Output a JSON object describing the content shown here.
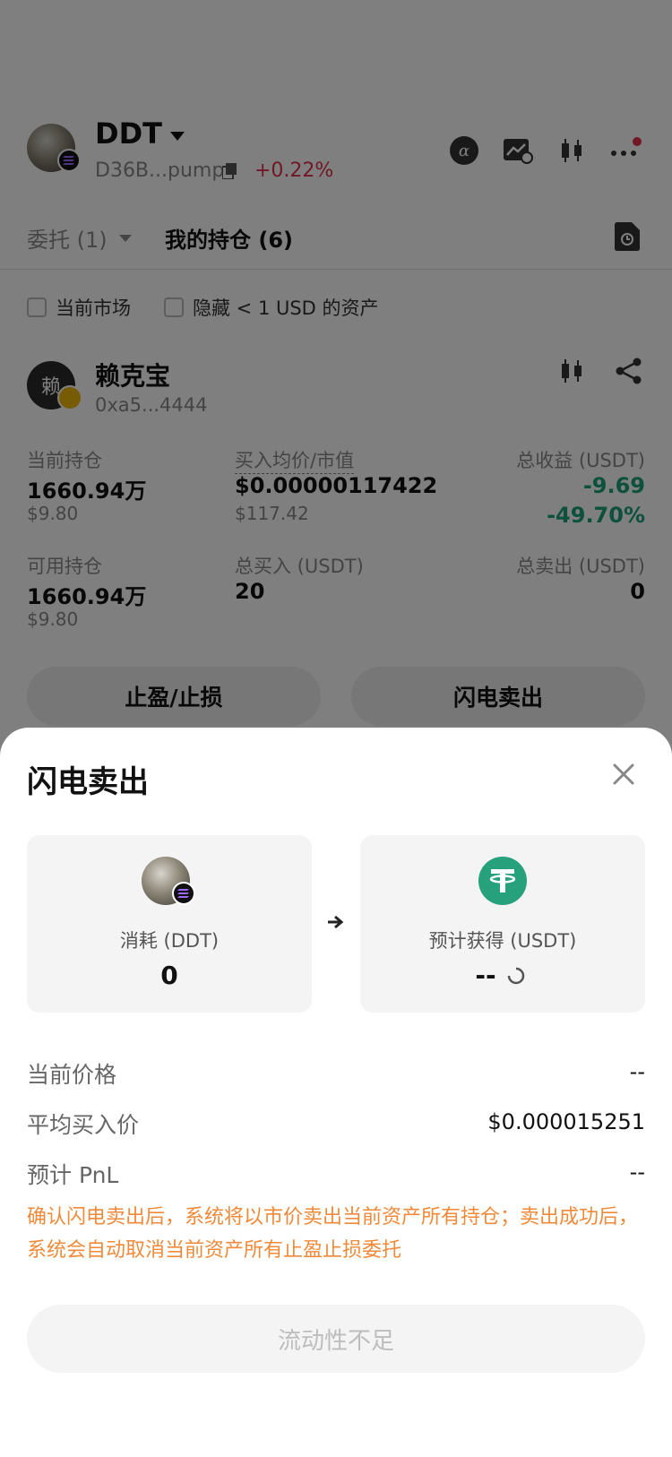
{
  "header": {
    "token_name": "DDT",
    "token_address": "D36B...pump",
    "price_change": "+0.22%"
  },
  "tabs": {
    "orders": "委托 (1)",
    "holdings": "我的持仓 (6)"
  },
  "filters": {
    "current_market": "当前市场",
    "hide_small": "隐藏 < 1 USD 的资产"
  },
  "position": {
    "avatar_text": "赖",
    "name": "赖克宝",
    "address": "0xa5...4444",
    "current_holding_label": "当前持仓",
    "current_holding_value": "1660.94万",
    "current_holding_usd": "$9.80",
    "avg_price_label": "买入均价/市值",
    "avg_price_value": "$0.00000117422",
    "market_value": "$117.42",
    "total_profit_label": "总收益 (USDT)",
    "total_profit_value": "-9.69",
    "total_profit_pct": "-49.70%",
    "available_label": "可用持仓",
    "available_value": "1660.94万",
    "available_usd": "$9.80",
    "total_buy_label": "总买入 (USDT)",
    "total_buy_value": "20",
    "total_sell_label": "总卖出 (USDT)",
    "total_sell_value": "0",
    "tp_sl_button": "止盈/止损",
    "flash_sell_button": "闪电卖出"
  },
  "sheet": {
    "title": "闪电卖出",
    "from_label": "消耗 (DDT)",
    "from_value": "0",
    "to_label": "预计获得 (USDT)",
    "to_value": "--",
    "current_price_label": "当前价格",
    "current_price_value": "--",
    "avg_buy_label": "平均买入价",
    "avg_buy_value": "$0.000015251",
    "pnl_label": "预计 PnL",
    "pnl_value": "--",
    "warning": "确认闪电卖出后，系统将以市价卖出当前资产所有持仓；卖出成功后，系统会自动取消当前资产所有止盈止损委托",
    "submit_label": "流动性不足"
  },
  "colors": {
    "positive": "#e0304d",
    "negative": "#1aa37a",
    "warning": "#f08a3a",
    "usdt": "#26a17b"
  }
}
